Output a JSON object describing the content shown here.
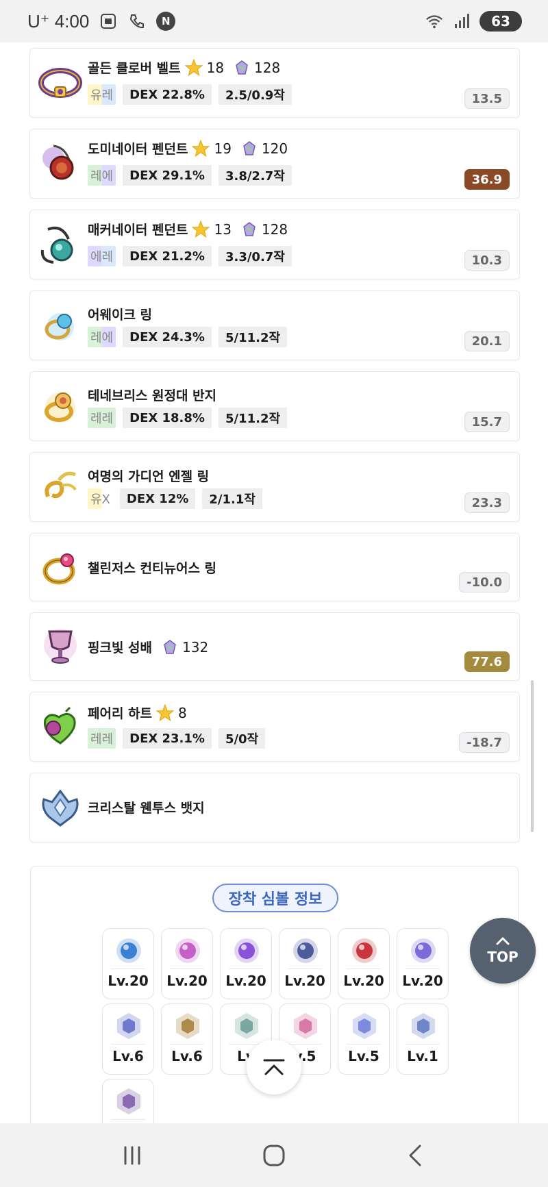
{
  "status_bar": {
    "carrier": "U⁺ 4:00",
    "battery": "63"
  },
  "items": [
    {
      "name": "골든 클로버 벨트",
      "star": "18",
      "gem": "128",
      "grade": "유레",
      "grade_colors": [
        "#fff6c9",
        "#dbe9ff"
      ],
      "stat": "DEX 22.8%",
      "scroll": "2.5/0.9작",
      "score": "13.5",
      "score_style": "plain",
      "icon": "golden-clover-belt-icon"
    },
    {
      "name": "도미네이터 펜던트",
      "star": "19",
      "gem": "120",
      "grade": "레에",
      "grade_colors": [
        "#d9f0d9",
        "#ded9ff"
      ],
      "stat": "DEX 29.1%",
      "scroll": "3.8/2.7작",
      "score": "36.9",
      "score_style": "brown",
      "icon": "dominator-pendant-icon"
    },
    {
      "name": "매커네이터 펜던트",
      "star": "13",
      "gem": "128",
      "grade": "에레",
      "grade_colors": [
        "#ded9ff",
        "#dbe9ff"
      ],
      "stat": "DEX 21.2%",
      "scroll": "3.3/0.7작",
      "score": "10.3",
      "score_style": "plain",
      "icon": "mechanator-pendant-icon"
    },
    {
      "name": "어웨이크 링",
      "star": "",
      "gem": "",
      "grade": "레에",
      "grade_colors": [
        "#d9f0d9",
        "#ded9ff"
      ],
      "stat": "DEX 24.3%",
      "scroll": "5/11.2작",
      "score": "20.1",
      "score_style": "plain",
      "icon": "awake-ring-icon"
    },
    {
      "name": "테네브리스 원정대 반지",
      "star": "",
      "gem": "",
      "grade": "레레",
      "grade_colors": [
        "#d9f0d9",
        "#d9f0d9"
      ],
      "stat": "DEX 18.8%",
      "scroll": "5/11.2작",
      "score": "15.7",
      "score_style": "plain",
      "icon": "tenebris-ring-icon"
    },
    {
      "name": "여명의 가디언 엔젤 링",
      "star": "",
      "gem": "",
      "grade": "유X",
      "grade_colors": [
        "#fff6c9",
        "#ffffff"
      ],
      "stat": "DEX 12%",
      "scroll": "2/1.1작",
      "score": "23.3",
      "score_style": "plain",
      "icon": "guardian-angel-ring-icon"
    },
    {
      "name": "챌린저스 컨티뉴어스 링",
      "star": "",
      "gem": "",
      "grade": "",
      "grade_colors": [],
      "stat": "",
      "scroll": "",
      "score": "-10.0",
      "score_style": "plain",
      "icon": "continuous-ring-icon"
    },
    {
      "name": "핑크빛 성배",
      "star": "",
      "gem": "132",
      "grade": "",
      "grade_colors": [],
      "stat": "",
      "scroll": "",
      "score": "77.6",
      "score_style": "gold",
      "icon": "pink-holy-cup-icon"
    },
    {
      "name": "페어리 하트",
      "star": "8",
      "gem": "",
      "grade": "레레",
      "grade_colors": [
        "#d9f0d9",
        "#d9f0d9"
      ],
      "stat": "DEX 23.1%",
      "scroll": "5/0작",
      "score": "-18.7",
      "score_style": "plain",
      "icon": "fairy-heart-icon"
    },
    {
      "name": "크리스탈 웬투스 뱃지",
      "star": "",
      "gem": "",
      "grade": "",
      "grade_colors": [],
      "stat": "",
      "scroll": "",
      "score": "",
      "score_style": "none",
      "icon": "crystal-ventus-badge-icon"
    }
  ],
  "symbols": {
    "title": "장착 심볼 정보",
    "rows": [
      [
        {
          "level": "Lv.20",
          "color": "#3b7fd6",
          "icon": "arcane-symbol-vanishing-journey-icon"
        },
        {
          "level": "Lv.20",
          "color": "#c35fc7",
          "icon": "arcane-symbol-chu-chu-icon"
        },
        {
          "level": "Lv.20",
          "color": "#8a52d8",
          "icon": "arcane-symbol-lachelein-icon"
        },
        {
          "level": "Lv.20",
          "color": "#4c5b9c",
          "icon": "arcane-symbol-arcana-icon"
        },
        {
          "level": "Lv.20",
          "color": "#c9353e",
          "icon": "arcane-symbol-morass-icon"
        },
        {
          "level": "Lv.20",
          "color": "#7b6ad8",
          "icon": "arcane-symbol-esfera-icon"
        }
      ],
      [
        {
          "level": "Lv.6",
          "color": "#6e7ad0",
          "icon": "authentic-symbol-cernium-icon"
        },
        {
          "level": "Lv.6",
          "color": "#b08a4a",
          "icon": "authentic-symbol-arcus-icon"
        },
        {
          "level": "Lv",
          "color": "#7aa7a0",
          "icon": "authentic-symbol-odium-icon"
        },
        {
          "level": "v.5",
          "color": "#d77aa6",
          "icon": "authentic-symbol-shangri-la-icon"
        },
        {
          "level": "Lv.5",
          "color": "#7c8be0",
          "icon": "authentic-symbol-arteria-icon"
        },
        {
          "level": "Lv.1",
          "color": "#6f86c9",
          "icon": "authentic-symbol-carcion-icon"
        }
      ],
      [
        {
          "level": "",
          "color": "#8a6ab0",
          "icon": "grand-authentic-symbol-icon"
        }
      ]
    ]
  },
  "top_button": {
    "label": "TOP"
  },
  "colors": {
    "score_brown": "#8a4a25",
    "score_gold": "#a48a3d",
    "symbol_title": "#3d67c5",
    "top_button": "#566170"
  }
}
